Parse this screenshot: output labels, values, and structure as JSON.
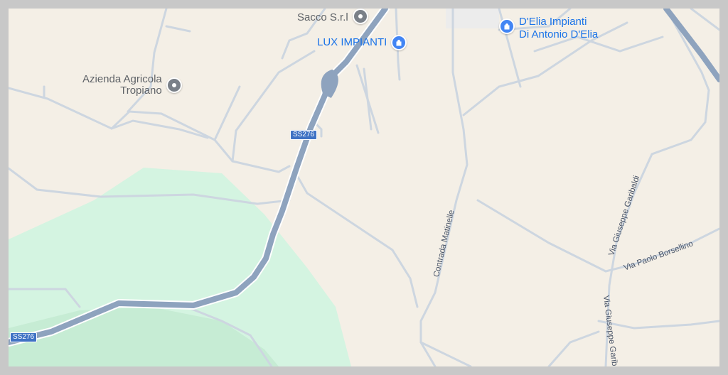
{
  "map": {
    "colors": {
      "land": "#f4efe6",
      "park": "#d4f4e1",
      "park_deep": "#c6ecd4",
      "minor_road": "#cdd6e0",
      "highway": "#8ea3be",
      "poi_gray": "#7a8088",
      "poi_blue": "#4285f4",
      "shield": "#3f72c4"
    },
    "pois": [
      {
        "name": "Sacco S.r.l",
        "icon": "place-pin-icon"
      },
      {
        "name": "LUX IMPIANTI",
        "icon": "shopping-bag-icon"
      },
      {
        "name": "D'Elia Impianti\nDi Antonio D'Elia",
        "icon": "shopping-bag-icon"
      },
      {
        "name": "Azienda Agricola\nTropiano",
        "icon": "place-pin-icon"
      }
    ],
    "road_shields": [
      "SS276",
      "SS276"
    ],
    "street_labels": [
      "Contrada Matinelle",
      "Via Giuseppe Garibaldi",
      "Via Paolo Borsellino",
      "Via Giuseppe Garibaldi"
    ]
  }
}
